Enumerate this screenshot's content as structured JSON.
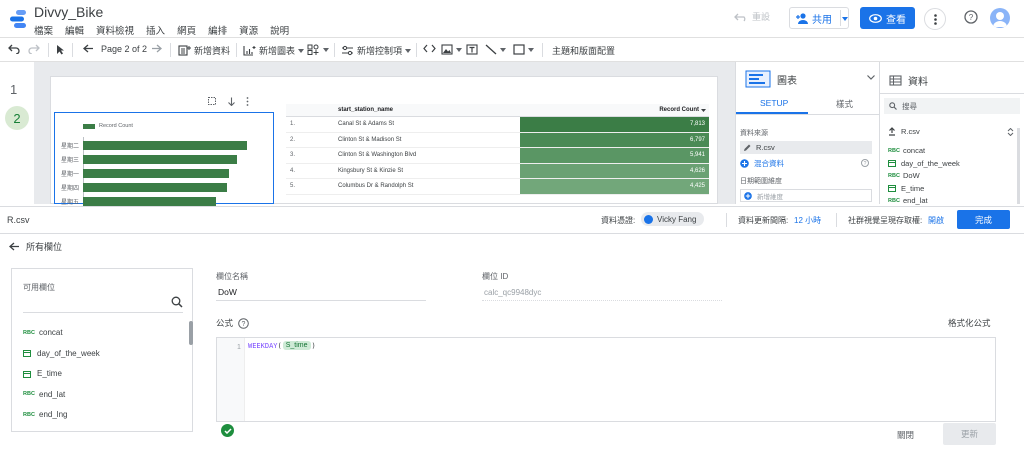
{
  "app": {
    "title": "Divvy_Bike",
    "menu": [
      "檔案",
      "編輯",
      "資料檢視",
      "插入",
      "網頁",
      "編排",
      "資源",
      "說明"
    ],
    "reset_label": "重設",
    "share_label": "共用",
    "view_label": "查看",
    "brand_color": "#1a73e8"
  },
  "toolbar": {
    "page_indicator": "Page 2 of 2",
    "add_data": "新增資料",
    "add_chart": "新增圖表",
    "add_control": "新增控制項",
    "theme": "主題和版面配置"
  },
  "pages": [
    "1",
    "2"
  ],
  "chart": {
    "legend": "Record Count",
    "bars": [
      {
        "label": "星期二",
        "value": 100
      },
      {
        "label": "星期三",
        "value": 94
      },
      {
        "label": "星期一",
        "value": 89
      },
      {
        "label": "星期四",
        "value": 88
      },
      {
        "label": "星期五",
        "value": 81
      }
    ]
  },
  "table": {
    "col_name": "start_station_name",
    "col_count": "Record Count",
    "rows": [
      {
        "idx": "1.",
        "name": "Canal St & Adams St",
        "count": "7,813",
        "shade": "#3b7d46"
      },
      {
        "idx": "2.",
        "name": "Clinton St & Madison St",
        "count": "6,797",
        "shade": "#4a8a55"
      },
      {
        "idx": "3.",
        "name": "Clinton St & Washington Blvd",
        "count": "5,941",
        "shade": "#5a9664"
      },
      {
        "idx": "4.",
        "name": "Kingsbury St & Kinzie St",
        "count": "4,626",
        "shade": "#6aa173"
      },
      {
        "idx": "5.",
        "name": "Columbus Dr & Randolph St",
        "count": "4,425",
        "shade": "#72a77a"
      }
    ]
  },
  "chart_panel": {
    "title": "圖表",
    "tab_setup": "SETUP",
    "tab_style": "樣式",
    "datasource_label": "資料來源",
    "datasource_value": "R.csv",
    "blend_label": "混合資料",
    "date_range_label": "日期範圍維度",
    "add_dimension": "新增維度"
  },
  "data_panel": {
    "title": "資料",
    "search_placeholder": "搜尋",
    "source": "R.csv",
    "fields": [
      {
        "type": "RBC",
        "name": "concat"
      },
      {
        "type": "cal",
        "name": "day_of_the_week"
      },
      {
        "type": "RBC",
        "name": "DoW"
      },
      {
        "type": "cal",
        "name": "E_time"
      },
      {
        "type": "RBC",
        "name": "end_lat"
      }
    ]
  },
  "edit": {
    "datasource": "R.csv",
    "credentials_label": "資料憑證:",
    "credentials_user": "Vicky Fang",
    "freshness_label": "資料更新間隔:",
    "freshness_value": "12 小時",
    "cache_label": "社群視覺呈現存取權:",
    "cache_value": "開啟",
    "done_label": "完成",
    "back_label": "所有欄位",
    "available_fields_label": "可用欄位",
    "available_fields": [
      {
        "type": "RBC",
        "name": "concat"
      },
      {
        "type": "cal",
        "name": "day_of_the_week"
      },
      {
        "type": "cal",
        "name": "E_time"
      },
      {
        "type": "RBC",
        "name": "end_lat"
      },
      {
        "type": "RBC",
        "name": "end_lng"
      }
    ],
    "field_name_label": "欄位名稱",
    "field_name_value": "DoW",
    "field_id_label": "欄位 ID",
    "field_id_value": "calc_qc9948dyc",
    "formula_label": "公式",
    "format_formula_label": "格式化公式",
    "line_number": "1",
    "formula_fn": "WEEKDAY",
    "formula_field": "S_time",
    "close_label": "關閉",
    "update_label": "更新"
  }
}
